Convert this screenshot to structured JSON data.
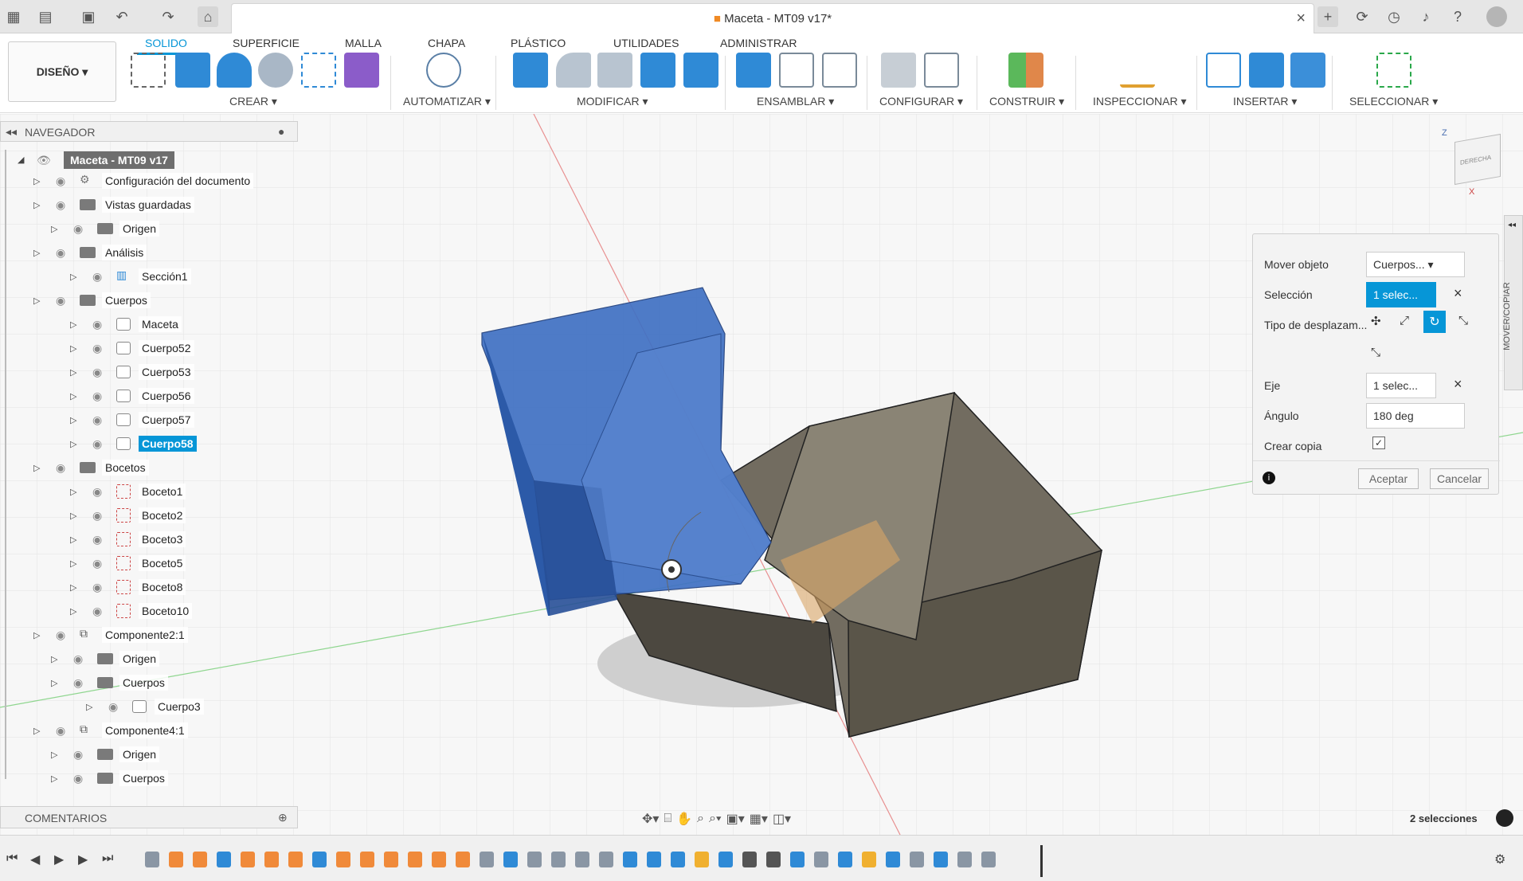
{
  "app": {
    "title": "Maceta - MT09 v17*"
  },
  "titlebar": {
    "icons": [
      "grid-icon",
      "file-icon",
      "save-icon",
      "undo-icon",
      "redo-icon",
      "home-icon",
      "add-tab-icon",
      "sync-icon",
      "history-icon",
      "bell-icon",
      "help-icon",
      "user-avatar-icon"
    ]
  },
  "ribbon": {
    "workspace": "DISEÑO",
    "tabs": [
      "SOLIDO",
      "SUPERFICIE",
      "MALLA",
      "CHAPA",
      "PLÁSTICO",
      "UTILIDADES",
      "ADMINISTRAR"
    ],
    "active_tab": "SOLIDO",
    "groups": [
      "CREAR",
      "AUTOMATIZAR",
      "MODIFICAR",
      "ENSAMBLAR",
      "CONFIGURAR",
      "CONSTRUIR",
      "INSPECCIONAR",
      "INSERTAR",
      "SELECCIONAR"
    ],
    "accent_color": "#0696d7"
  },
  "navigator": {
    "title": "NAVEGADOR",
    "root": "Maceta - MT09 v17",
    "items": [
      {
        "label": "Configuración del documento",
        "icon": "gear-icon"
      },
      {
        "label": "Vistas guardadas",
        "icon": "folder-icon"
      },
      {
        "label": "Origen",
        "icon": "folder-icon"
      },
      {
        "label": "Análisis",
        "icon": "folder-icon"
      },
      {
        "label": "Sección1",
        "icon": "section-icon"
      },
      {
        "label": "Cuerpos",
        "icon": "folder-icon"
      },
      {
        "label": "Maceta",
        "icon": "body-icon"
      },
      {
        "label": "Cuerpo52",
        "icon": "body-icon"
      },
      {
        "label": "Cuerpo53",
        "icon": "body-icon"
      },
      {
        "label": "Cuerpo56",
        "icon": "body-icon"
      },
      {
        "label": "Cuerpo57",
        "icon": "body-icon"
      },
      {
        "label": "Cuerpo58",
        "icon": "body-icon",
        "selected": true
      },
      {
        "label": "Bocetos",
        "icon": "folder-icon"
      },
      {
        "label": "Boceto1",
        "icon": "sketch-icon"
      },
      {
        "label": "Boceto2",
        "icon": "sketch-icon"
      },
      {
        "label": "Boceto3",
        "icon": "sketch-icon"
      },
      {
        "label": "Boceto5",
        "icon": "sketch-icon"
      },
      {
        "label": "Boceto8",
        "icon": "sketch-icon"
      },
      {
        "label": "Boceto10",
        "icon": "sketch-icon"
      },
      {
        "label": "Componente2:1",
        "icon": "component-icon"
      },
      {
        "label": "Origen",
        "icon": "folder-icon"
      },
      {
        "label": "Cuerpos",
        "icon": "folder-icon"
      },
      {
        "label": "Cuerpo3",
        "icon": "body-icon"
      },
      {
        "label": "Componente4:1",
        "icon": "component-icon"
      },
      {
        "label": "Origen",
        "icon": "folder-icon"
      },
      {
        "label": "Cuerpos",
        "icon": "folder-icon"
      }
    ]
  },
  "comments": {
    "title": "COMENTARIOS"
  },
  "viewcube": {
    "face": "DERECHA",
    "axis_z": "Z",
    "axis_x": "X"
  },
  "side_tab": {
    "label": "MOVER/COPIAR"
  },
  "dialog": {
    "mover_objeto_label": "Mover objeto",
    "mover_objeto_value": "Cuerpos...",
    "seleccion_label": "Selección",
    "seleccion_value": "1 selec...",
    "tipo_label": "Tipo de desplazam...",
    "eje_label": "Eje",
    "eje_value": "1 selec...",
    "angulo_label": "Ángulo",
    "angulo_value": "180 deg",
    "crear_copia_label": "Crear copia",
    "crear_copia_checked": true,
    "accept": "Aceptar",
    "cancel": "Cancelar"
  },
  "status": {
    "selections": "2 selecciones"
  },
  "colors": {
    "selected_body": "#3f6fc2",
    "body": "#6a655b",
    "shadow": "#d8d8d8"
  }
}
